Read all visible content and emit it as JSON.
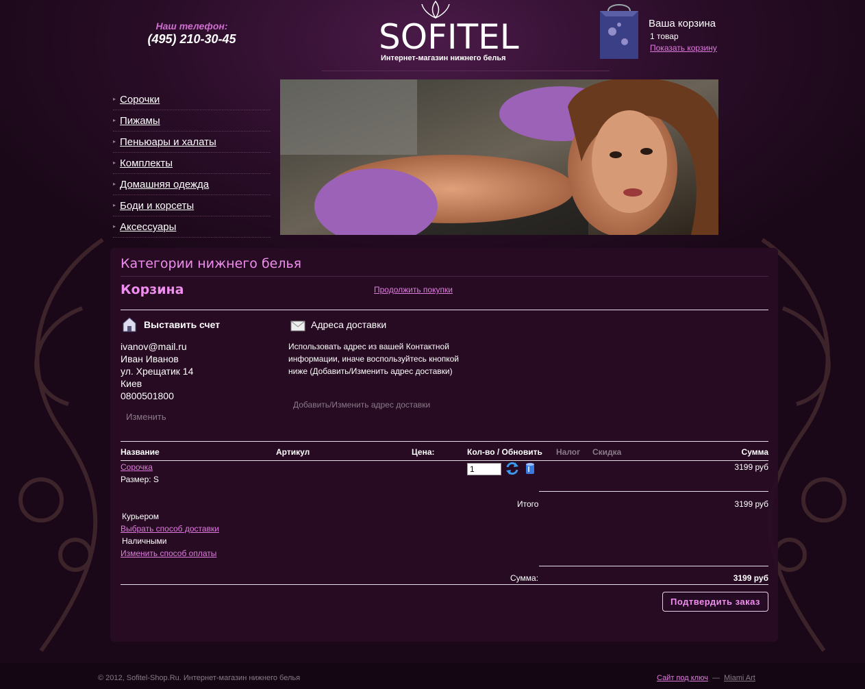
{
  "header": {
    "phone_label": "Наш телефон:",
    "phone_number": "(495) 210-30-45",
    "logo_text": "SOFITEL",
    "logo_subtitle": "Интернет-магазин нижнего белья",
    "cart": {
      "title": "Ваша корзина",
      "count": "1 товар",
      "show_link": "Показать корзину"
    }
  },
  "menu": {
    "items": [
      "Сорочки",
      "Пижамы",
      "Пеньюары и халаты",
      "Комплекты",
      "Домашняя одежда",
      "Боди и корсеты",
      "Аксессуары"
    ]
  },
  "main": {
    "category_title": "Категории нижнего белья",
    "cart_heading": "Корзина",
    "continue_link": "Продолжить покупки",
    "billing": {
      "title": "Выставить счет",
      "lines": [
        "ivanov@mail.ru",
        "Иван Иванов",
        "ул. Хрещатик 14",
        "Киев",
        "0800501800"
      ],
      "edit_button": "Изменить"
    },
    "shipping": {
      "title": "Адреса доставки",
      "description": "Использовать адрес из вашей Контактной информации, иначе воспользуйтесь кнопкой ниже (Добавить/Изменить адрес доставки)",
      "button": "Добавить/Изменить адрес доставки"
    },
    "table": {
      "headers": {
        "name": "Название",
        "sku": "Артикул",
        "price": "Цена:",
        "qty": "Кол-во / Обновить",
        "tax": "Налог",
        "discount": "Скидка",
        "sum": "Сумма"
      },
      "row": {
        "name": "Сорочка",
        "size": "Размер: S",
        "qty": "1",
        "sum": "3199 руб"
      },
      "itogo_label": "Итого",
      "itogo_value": "3199 руб",
      "delivery_method": "Курьером",
      "delivery_link": "Выбрать способ доставки",
      "payment_method": "Наличными",
      "payment_link": "Изменить способ оплаты",
      "total_label": "Сумма:",
      "total_value": "3199 руб"
    },
    "confirm_button": "Подтвердить заказ"
  },
  "footer": {
    "copyright": "© 2012, Sofitel-Shop.Ru. Интернет-магазин нижнего белья",
    "link1": "Сайт под ключ",
    "separator": "—",
    "link2": "Miami Art"
  },
  "colors": {
    "accent": "#f08ef0",
    "link": "#e07be0",
    "background": "#1e0a1c"
  }
}
